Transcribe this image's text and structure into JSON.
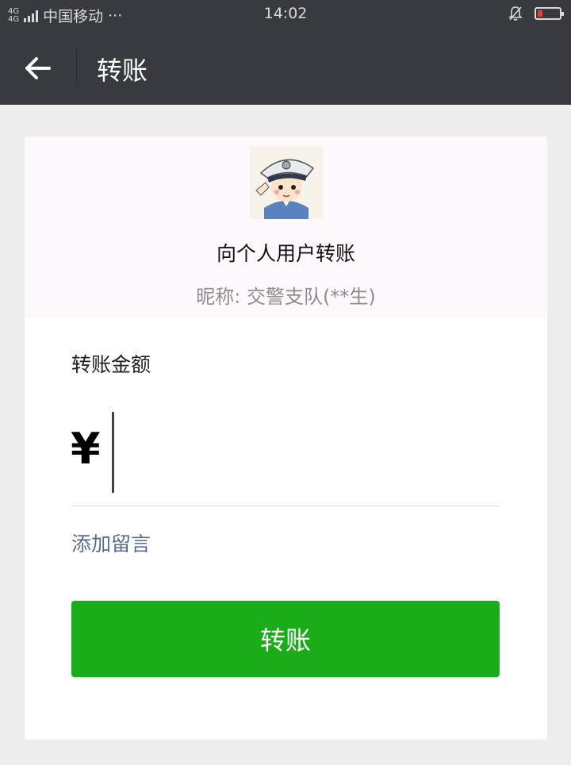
{
  "status_bar": {
    "network": "4G",
    "carrier": "中国移动",
    "more": "···",
    "time": "14:02"
  },
  "nav": {
    "title": "转账"
  },
  "recipient": {
    "title": "向个人用户转账",
    "nickname": "昵称: 交警支队(**生)"
  },
  "amount": {
    "label": "转账金额",
    "currency": "¥",
    "value": ""
  },
  "add_note": "添加留言",
  "submit_label": "转账",
  "colors": {
    "header": "#393a3f",
    "primary_button": "#1aad19",
    "link": "#576b95",
    "battery_low": "#e63d3d"
  },
  "icons": {
    "back": "arrow-left-icon",
    "silent": "bell-off-icon",
    "battery": "battery-low-icon",
    "signal": "signal-icon"
  }
}
